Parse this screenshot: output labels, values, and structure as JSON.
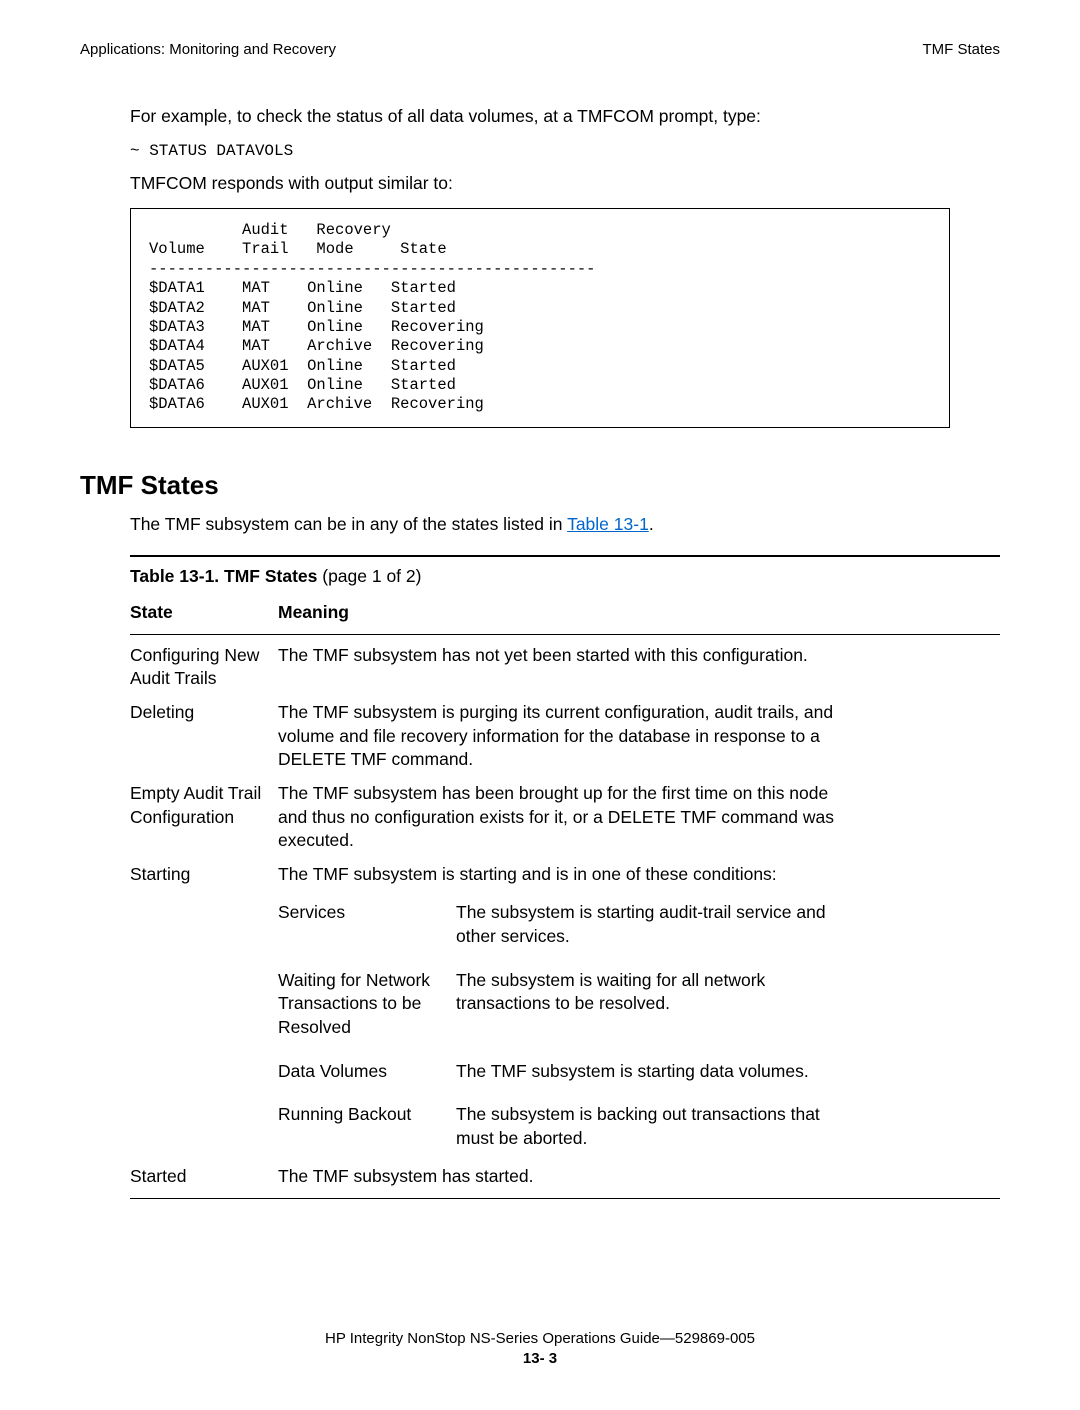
{
  "header": {
    "left": "Applications: Monitoring and Recovery",
    "right": "TMF States"
  },
  "intro": {
    "p1": "For example, to check the status of all data volumes, at a TMFCOM prompt, type:",
    "cmd": "~ STATUS DATAVOLS",
    "p2": "TMFCOM responds with output similar to:"
  },
  "output": "          Audit   Recovery\nVolume    Trail   Mode     State\n------------------------------------------------\n$DATA1    MAT    Online   Started\n$DATA2    MAT    Online   Started\n$DATA3    MAT    Online   Recovering\n$DATA4    MAT    Archive  Recovering\n$DATA5    AUX01  Online   Started\n$DATA6    AUX01  Online   Started\n$DATA6    AUX01  Archive  Recovering",
  "section_heading": "TMF States",
  "section_para_before": "The TMF subsystem can be in any of the states listed in ",
  "table_link_text": "Table 13-1",
  "section_para_after": ".",
  "table_title_bold": "Table 13-1.  TMF States",
  "table_title_rest": "  (page 1 of 2)",
  "col_headers": {
    "state": "State",
    "meaning": "Meaning"
  },
  "rows": [
    {
      "state": "Configuring New Audit Trails",
      "meaning": "The TMF subsystem has not yet been started with this configuration."
    },
    {
      "state": "Deleting",
      "meaning": "The TMF subsystem is purging its current configuration, audit trails, and volume and file recovery information for the database in response to a DELETE TMF command."
    },
    {
      "state": "Empty Audit Trail Configuration",
      "meaning": "The TMF subsystem has been brought up for the first time on this node and thus no configuration exists for it, or a DELETE TMF command was executed."
    },
    {
      "state": "Starting",
      "meaning_intro": "The TMF subsystem is starting and is in one of these conditions:",
      "subrows": [
        {
          "label": "Services",
          "text": "The subsystem is starting audit-trail service and other services."
        },
        {
          "label": "Waiting for Network Transactions to be Resolved",
          "text": "The subsystem is waiting for all network transactions to be resolved."
        },
        {
          "label": "Data Volumes",
          "text": "The TMF subsystem is starting data volumes."
        },
        {
          "label": "Running Backout",
          "text": "The subsystem is backing out transactions that must be aborted."
        }
      ]
    },
    {
      "state": "Started",
      "meaning": "The TMF subsystem has started."
    }
  ],
  "footer": {
    "line1": "HP Integrity NonStop NS-Series Operations Guide—529869-005",
    "pagenum": "13- 3"
  }
}
